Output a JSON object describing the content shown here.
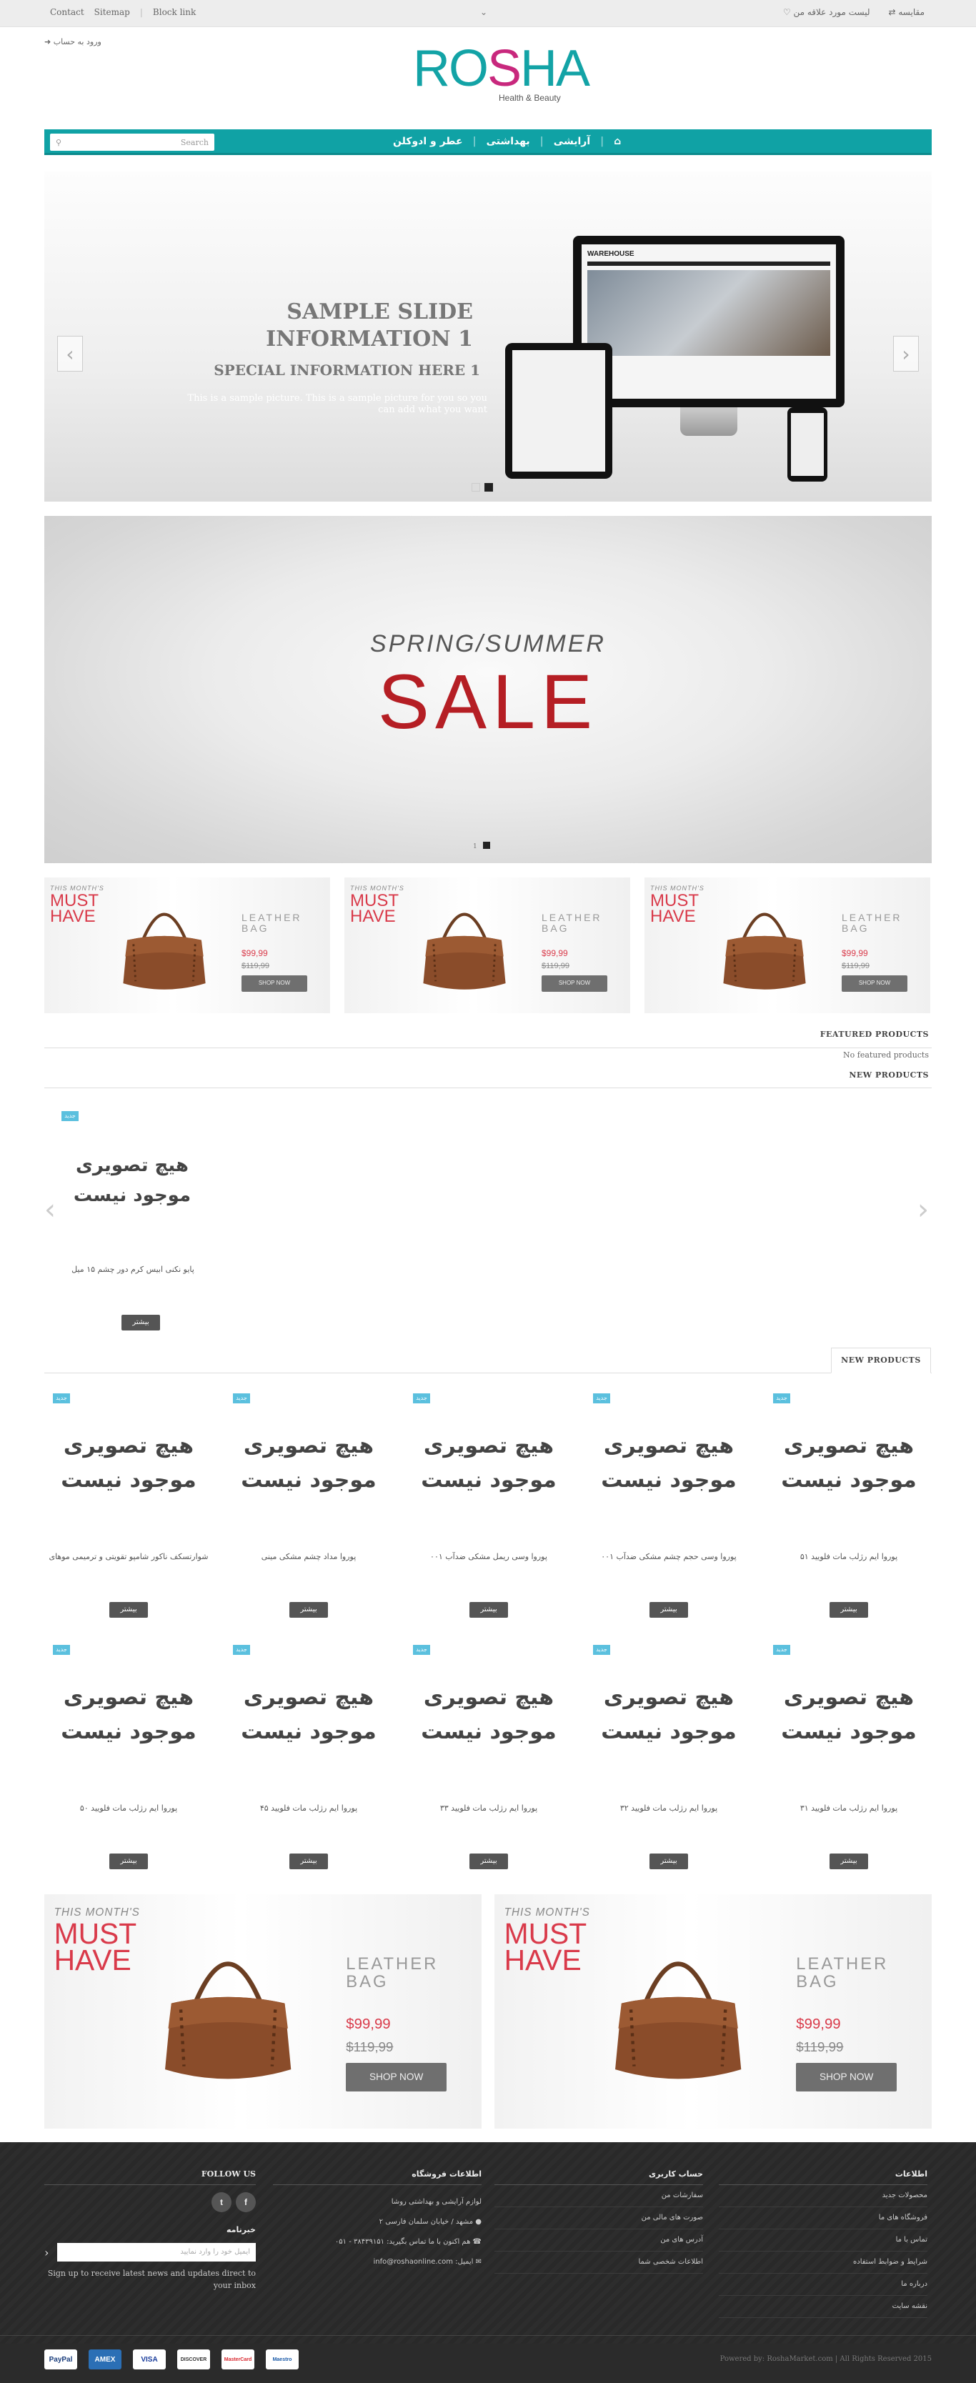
{
  "topbar": {
    "links": [
      "Contact",
      "Sitemap",
      "|",
      "Block link"
    ],
    "chevron": "chevron-down-icon",
    "compare": "مقایسه",
    "wishlist": "لیست مورد علاقه من"
  },
  "header": {
    "login": "ورود به حساب",
    "logo_text_a": "RO",
    "logo_text_b": "S",
    "logo_text_c": "HA",
    "logo_tagline": "Health & Beauty"
  },
  "nav": {
    "search_placeholder": "Search",
    "items": [
      "عطر و ادوکلن",
      "بهداشتی",
      "آرایشی"
    ]
  },
  "slider1": {
    "title": "SAMPLE SLIDE INFORMATION 1",
    "subtitle": "SPECIAL INFORMATION HERE 1",
    "description": "This is a sample picture. This is a sample picture for you so you can add what you want",
    "screen_brand": "WAREHOUSE"
  },
  "slider2": {
    "line1": "SPRING/SUMMER",
    "line2": "SALE",
    "dot_label": "1"
  },
  "banner": {
    "this_month": "THIS MONTH'S",
    "must": "MUST",
    "have": "HAVE",
    "leather": "LEATHER",
    "bag": "BAG",
    "price": "$99,99",
    "old_price": "$119,99",
    "button": "SHOP NOW"
  },
  "featured": {
    "title": "FEATURED PRODUCTS",
    "empty": "No featured products"
  },
  "new_products": {
    "title": "NEW PRODUCTS",
    "badge": "جدید",
    "no_image_1": "هیچ تصویری",
    "no_image_2": "موجود نیست",
    "more": "بیشتر",
    "carousel_product": "پایو نکنی ابیس کرم دور چشم ۱۵ میل"
  },
  "tab": {
    "title": "NEW PRODUCTS"
  },
  "grid_row1": [
    "پوروا ایم رژلب مات فلویید ۵۱",
    "پوروا وسی حجم چشم مشکی ضدآب ۰۰۱",
    "پوروا وسی ریمل مشکی ضدآب ۰۰۱",
    "پوروا مداد چشم مشکی مینی",
    "شوارتسکف ناکور شامپو تقویتی و ترمیمی موهای"
  ],
  "grid_row2": [
    "پوروا ایم رژلب مات فلویید ۳۱",
    "پوروا ایم رژلب مات فلویید ۳۲",
    "پوروا ایم رژلب مات فلویید ۳۳",
    "پوروا ایم رژلب مات فلویید ۴۵",
    "پوروا ایم رژلب مات فلویید ۵۰"
  ],
  "footer": {
    "col_info_title": "اطلاعات",
    "col_info_links": [
      "محصولات جدید",
      "فروشگاه های ما",
      "تماس با ما",
      "شرایط و ضوابط استفاده",
      "درباره ما",
      "نقشه سایت"
    ],
    "col_account_title": "حساب کاربری",
    "col_account_links": [
      "سفارشات من",
      "صورت های مالی من",
      "آدرس های من",
      "اطلاعات شخصی شما"
    ],
    "col_store_title": "اطلاعات فروشگاه",
    "store_name": "لوازم آرایشی و بهداشتی روشا",
    "store_address": "مشهد / خیابان سلمان فارسی ۲",
    "store_phone": "هم اکنون با ما تماس بگیرید: ۳۸۴۳۹۱۵۱ - ۰۵۱",
    "store_email": "ایمیل: info@roshaonline.com",
    "follow_title": "FOLLOW US",
    "newsletter_title": "خبرنامه",
    "newsletter_placeholder": "ایمیل خود را وارد نمایید",
    "newsletter_text": "Sign up to receive latest news and updates direct to your inbox",
    "copyright": "Powered by: RoshaMarket.com | All Rights Reserved 2015",
    "payments": [
      "PayPal",
      "AMEX",
      "VISA",
      "DISCOVER",
      "MasterCard",
      "Maestro"
    ]
  },
  "colors": {
    "brand_teal": "#10a2a5",
    "brand_magenta": "#c8287d",
    "sale_red": "#b51e24",
    "footer_bg": "#2b2b2b"
  }
}
